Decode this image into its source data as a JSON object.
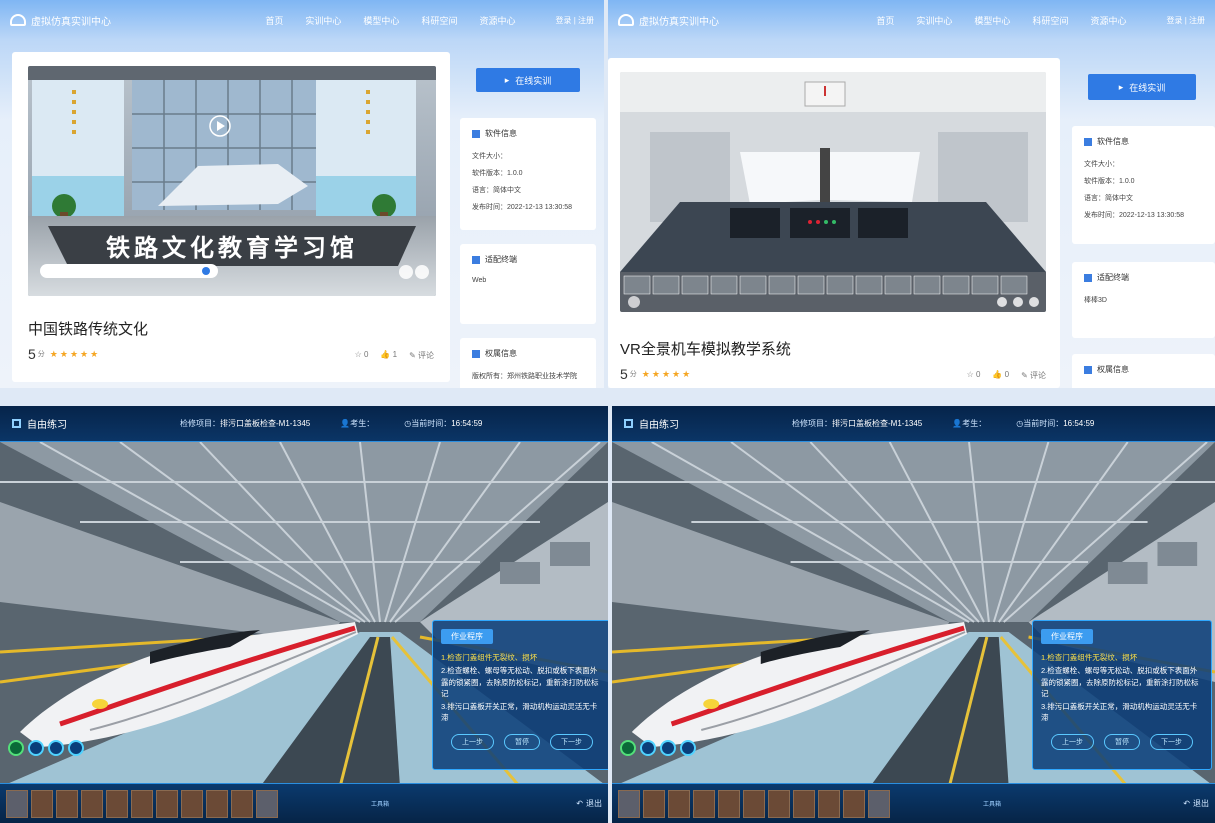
{
  "portal": {
    "site_name": "虚拟仿真实训中心",
    "nav": [
      "首页",
      "实训中心",
      "模型中心",
      "科研空间",
      "资源中心"
    ],
    "login": "登录 | 注册",
    "online_button": "在线实训",
    "software_info_title": "软件信息",
    "file_size_label": "文件大小：",
    "version_label": "软件版本：1.0.0",
    "language_label": "语言：简体中文",
    "publish_time_label": "发布时间：2022-12-13 13:30:58",
    "platform_title": "适配终端",
    "rights_title": "权属信息",
    "rights_owner": "版权所有：郑州铁路职业技术学院"
  },
  "course1": {
    "title": "中国铁路传统文化",
    "hall_sign": "铁路文化教育学习馆",
    "rating": "5",
    "rating_unit": "分",
    "platform": "Web",
    "likes": "0",
    "thumbs": "1",
    "comment_label": "评论"
  },
  "course2": {
    "title": "VR全景机车模拟教学系统",
    "rating": "5",
    "rating_unit": "分",
    "platform": "棒棒3D",
    "likes": "0",
    "thumbs": "0",
    "comment_label": "评论"
  },
  "sim": {
    "mode": "自由练习",
    "task_label": "检修项目：",
    "task_value": "排污口盖板检查-M1-1345",
    "examinee_label": "考生：",
    "time_label": "当前时间：",
    "time_value": "16:54:59",
    "panel_tab": "作业程序",
    "steps": [
      "1.检查门盖组件无裂纹、损坏",
      "2.检查螺栓、螺母等无松动、脱扣或板下表面外露的锁紧圈，去除原防松标记，重新涂打防松标记",
      "3.排污口盖板开关正常，滑动机构运动灵活无卡滞"
    ],
    "btn_prev": "上一步",
    "btn_pause": "暂停",
    "btn_next": "下一步",
    "exit_label": "退出",
    "toolbox_label": "工具箱"
  },
  "colors": {
    "accent": "#2f7ae4",
    "hud": "#0b3566",
    "highlight": "#ffe24a"
  }
}
